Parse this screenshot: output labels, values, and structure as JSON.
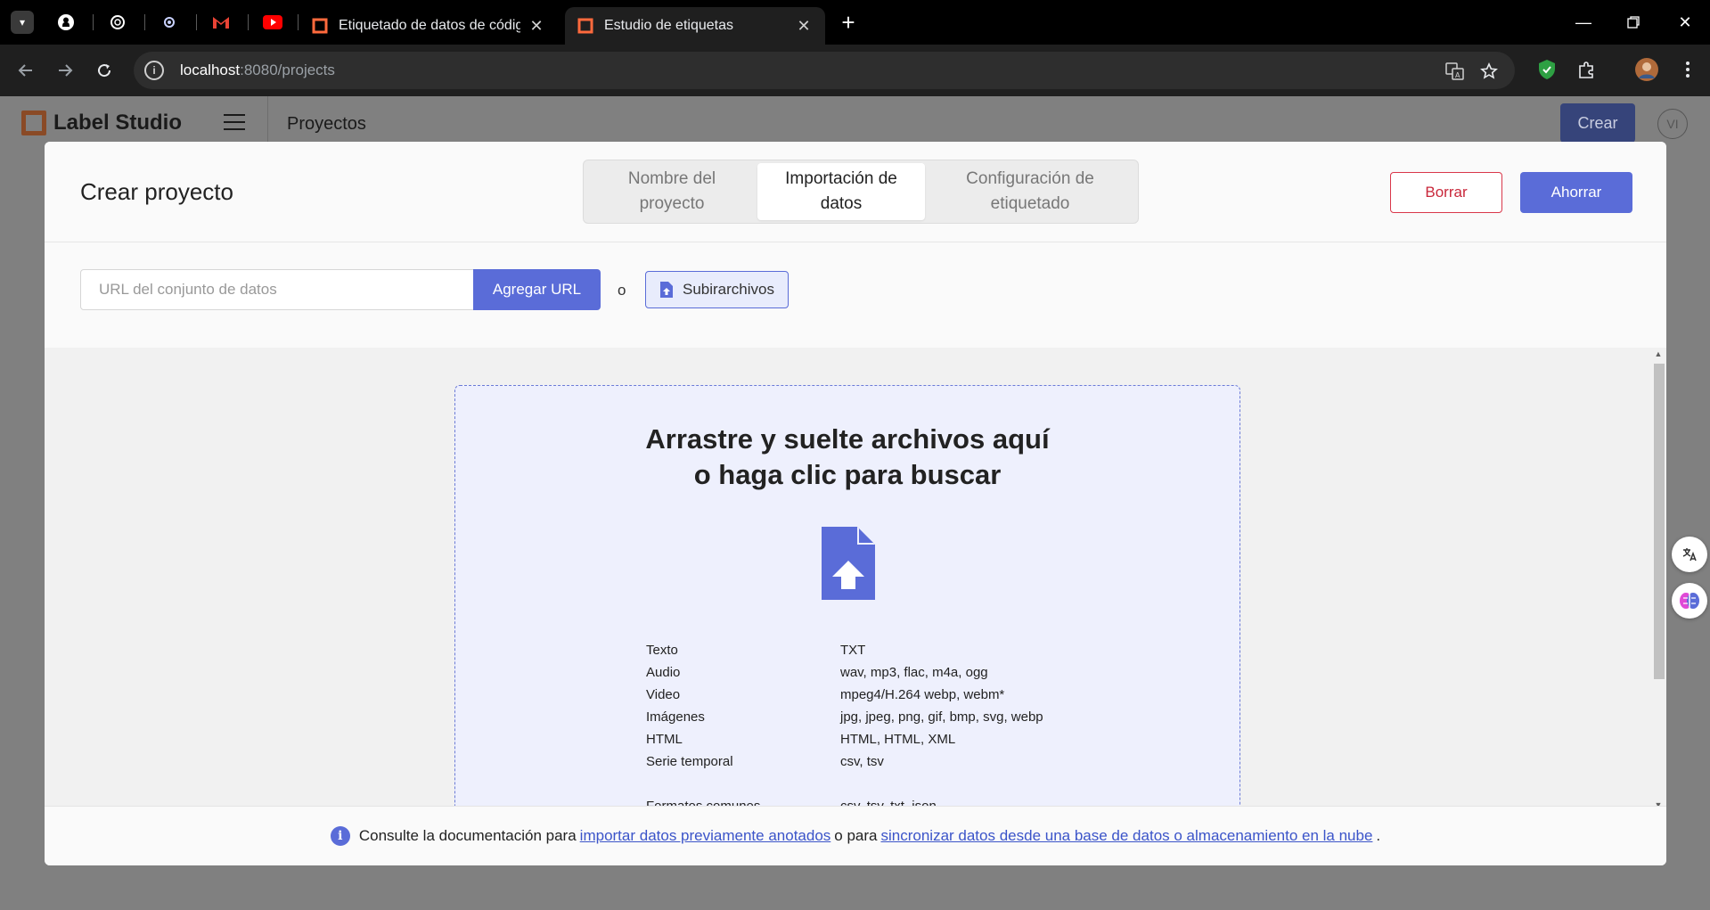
{
  "browser": {
    "tabs": [
      {
        "title": "Etiquetado de datos de código",
        "active": false
      },
      {
        "title": "Estudio de etiquetas",
        "active": true
      }
    ],
    "address": {
      "host": "localhost",
      "path": ":8080/projects"
    }
  },
  "app": {
    "logo_text": "Label Studio",
    "section_title": "Proyectos",
    "create_label": "Crear",
    "avatar_initials": "VI"
  },
  "modal": {
    "title": "Crear proyecto",
    "steps": [
      {
        "label": "Nombre del proyecto",
        "active": false
      },
      {
        "label": "Importación de datos",
        "active": true
      },
      {
        "label": "Configuración de etiquetado",
        "active": false
      }
    ],
    "delete_label": "Borrar",
    "save_label": "Ahorrar",
    "url_placeholder": "URL del conjunto de datos",
    "add_url_label": "Agregar URL",
    "or_text": "o",
    "upload_label": "Subirarchivos",
    "drop_title_line1": "Arrastre y suelte archivos aquí",
    "drop_title_line2": "o haga clic para buscar",
    "formats": [
      {
        "type": "Texto",
        "ext": "TXT"
      },
      {
        "type": "Audio",
        "ext": "wav, mp3, flac, m4a, ogg"
      },
      {
        "type": "Video",
        "ext": "mpeg4/H.264 webp, webm*"
      },
      {
        "type": "Imágenes",
        "ext": "jpg, jpeg, png, gif, bmp, svg, webp"
      },
      {
        "type": "HTML",
        "ext": "HTML, HTML, XML"
      },
      {
        "type": "Serie temporal",
        "ext": "csv, tsv"
      },
      {
        "type": "Formatos comunes",
        "ext": "csv, tsv, txt, json"
      }
    ],
    "footer": {
      "text1": "Consulte la documentación para",
      "link1": "importar datos previamente anotados",
      "text2": "o para",
      "link2": "sincronizar datos desde una base de datos o almacenamiento en la nube",
      "text3": "."
    }
  },
  "colors": {
    "accent": "#5a6cd8",
    "danger": "#d9374a",
    "drop_bg": "#eef0fd"
  }
}
